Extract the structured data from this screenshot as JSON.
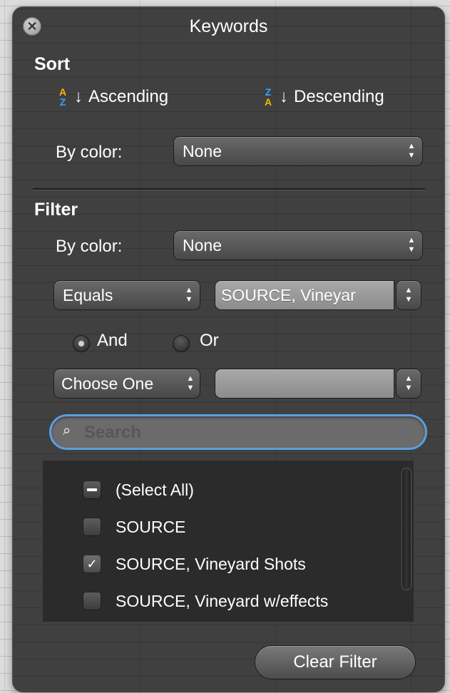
{
  "window": {
    "title": "Keywords",
    "close_glyph": "✕"
  },
  "sort": {
    "heading": "Sort",
    "ascending_label": "Ascending",
    "descending_label": "Descending",
    "az_icon": {
      "top": "A",
      "bottom": "Z"
    },
    "za_icon": {
      "top": "Z",
      "bottom": "A"
    },
    "arrow_glyph": "↓",
    "by_color_label": "By color:",
    "by_color_value": "None"
  },
  "filter": {
    "heading": "Filter",
    "by_color_label": "By color:",
    "by_color_value": "None",
    "condition1_operator": "Equals",
    "condition1_value": "SOURCE, Vineyar",
    "and_label": "And",
    "or_label": "Or",
    "selected_conjunction": "And",
    "condition2_operator": "Choose One",
    "condition2_value": "",
    "search_placeholder": "Search",
    "search_icon": "magnifying-glass",
    "items": [
      {
        "label": "(Select All)",
        "state": "mixed"
      },
      {
        "label": "SOURCE",
        "state": "unchecked"
      },
      {
        "label": "SOURCE, Vineyard Shots",
        "state": "checked"
      },
      {
        "label": "SOURCE, Vineyard w/effects",
        "state": "unchecked"
      }
    ],
    "check_glyph": "✓",
    "clear_button": "Clear Filter"
  },
  "colors": {
    "panel_bg": "#404040",
    "focus_ring": "#5b9fe0",
    "sort_icon_yellow": "#f5b800",
    "sort_icon_blue": "#3aa0ff"
  }
}
